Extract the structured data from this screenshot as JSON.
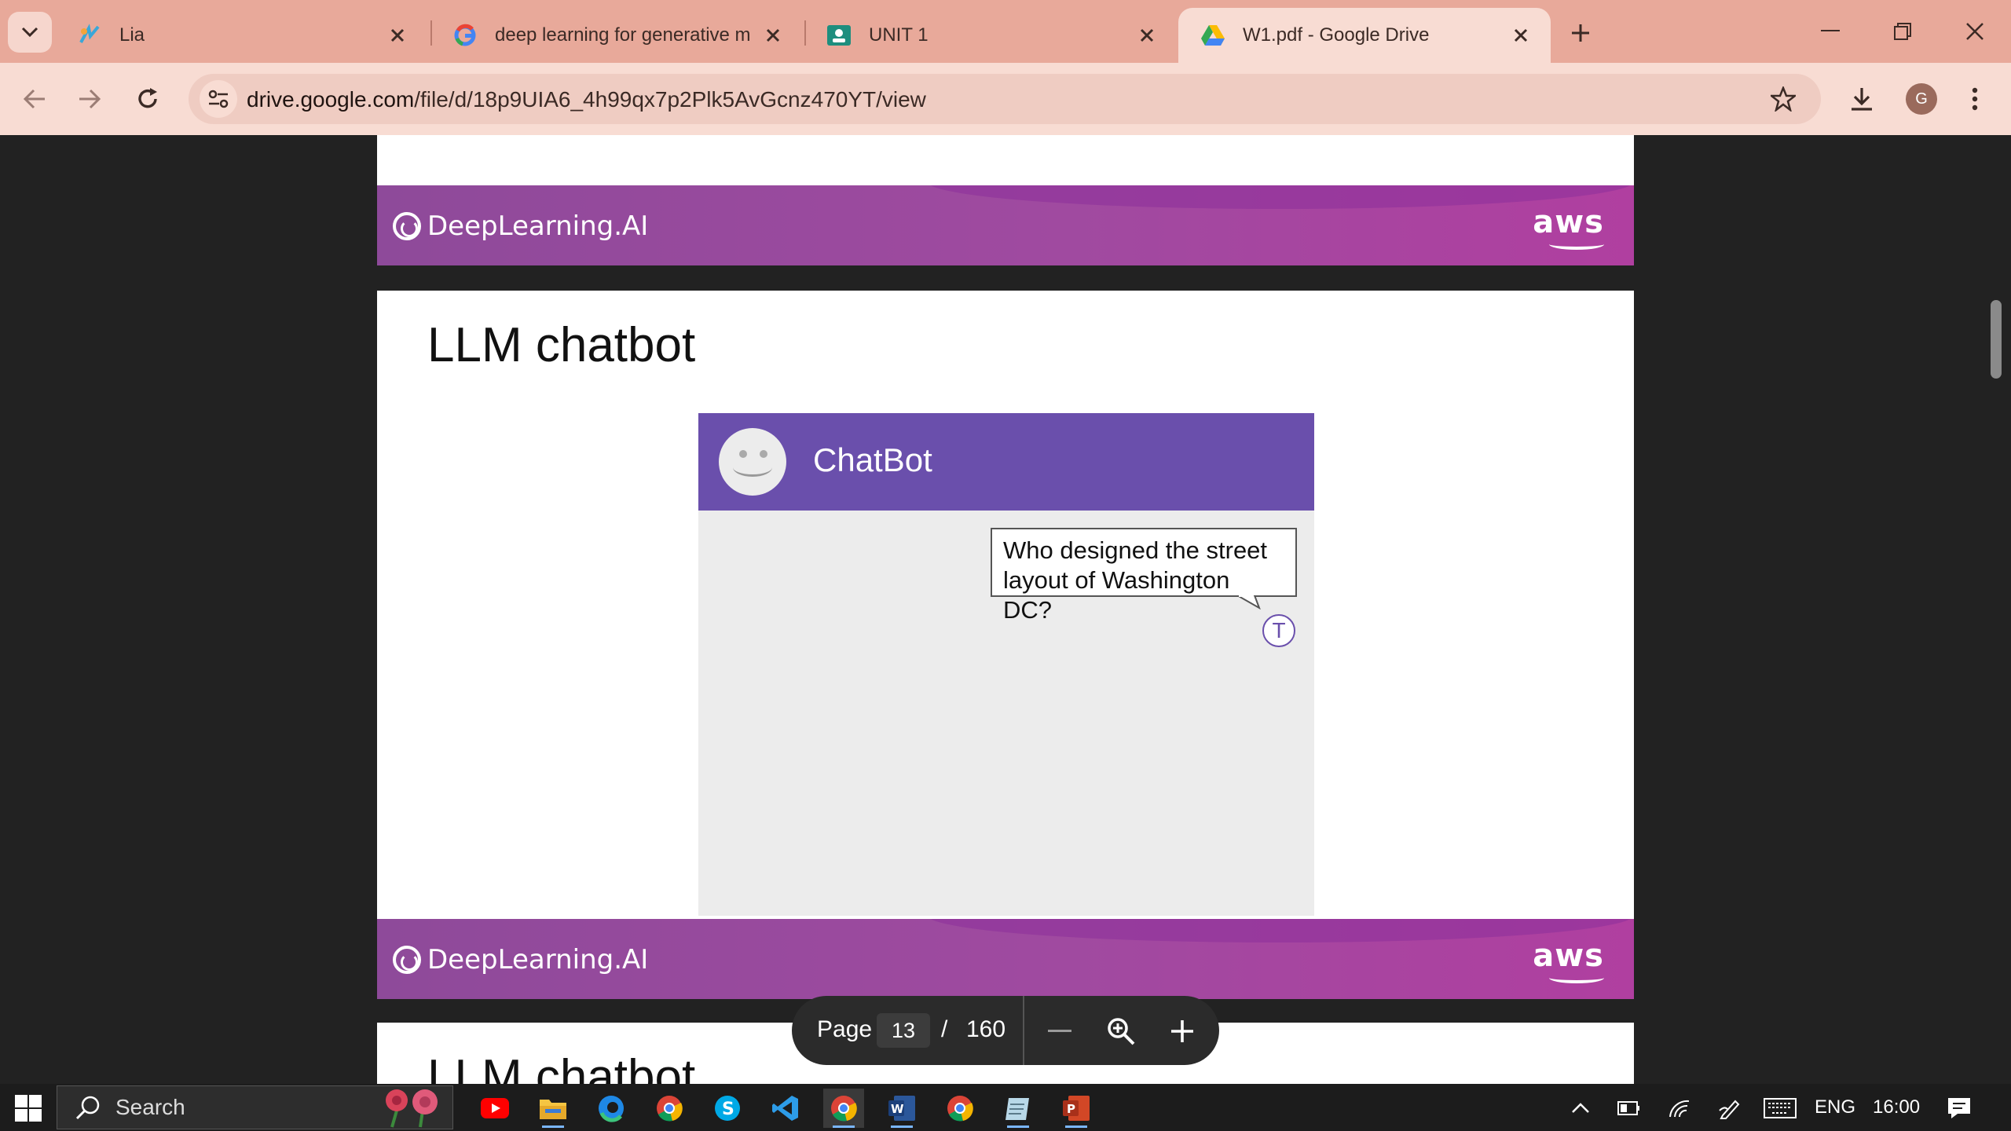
{
  "browser": {
    "tabs": [
      {
        "title": "Lia",
        "icon": "lia-logo-icon"
      },
      {
        "title": "deep learning for generative m",
        "icon": "google-logo-icon"
      },
      {
        "title": "UNIT 1",
        "icon": "classroom-icon"
      },
      {
        "title": "W1.pdf - Google Drive",
        "icon": "google-drive-icon",
        "active": true
      }
    ],
    "url_domain": "drive.google.com",
    "url_path": "/file/d/18p9UIA6_4h99qx7p2Plk5AvGcnz470YT/view",
    "profile_initial": "G"
  },
  "slides": {
    "logo_text": "DeepLearning.AI",
    "aws_text": "aws",
    "current_title": "LLM chatbot",
    "next_title": "LLM chatbot",
    "chatbot_name": "ChatBot",
    "user_message": "Who designed the street layout of Washington DC?",
    "user_initial": "T"
  },
  "viewer": {
    "page_label": "Page",
    "page_current": "13",
    "page_sep": "/",
    "page_total": "160"
  },
  "taskbar": {
    "search_label": "Search",
    "lang": "ENG",
    "time": "16:00"
  },
  "colors": {
    "tab_bar": "#e8a99a",
    "toolbar": "#f8dcd3",
    "banner": "#a04aa0",
    "chat_header": "#6a4fac"
  }
}
